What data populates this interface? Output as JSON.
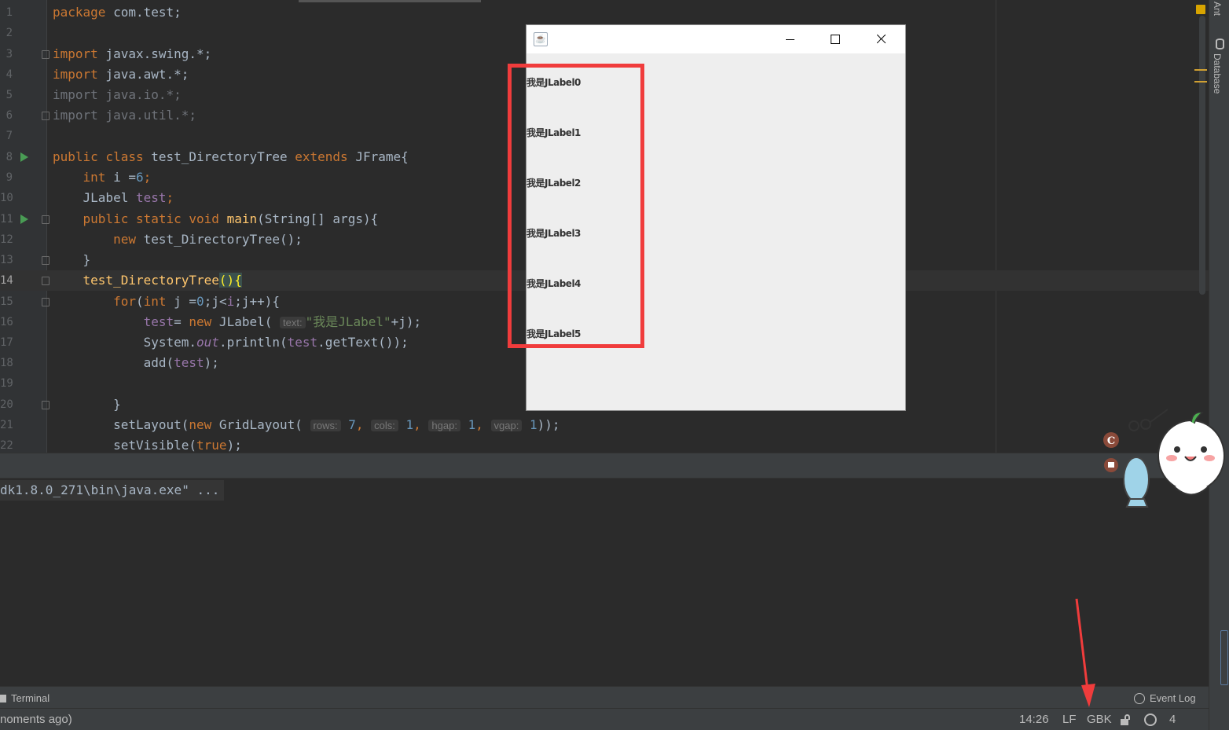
{
  "editor": {
    "lines": [
      {
        "n": "1"
      },
      {
        "n": "2"
      },
      {
        "n": "3"
      },
      {
        "n": "4"
      },
      {
        "n": "5"
      },
      {
        "n": "6"
      },
      {
        "n": "7"
      },
      {
        "n": "8"
      },
      {
        "n": "9"
      },
      {
        "n": "10"
      },
      {
        "n": "11"
      },
      {
        "n": "12"
      },
      {
        "n": "13"
      },
      {
        "n": "14"
      },
      {
        "n": "15"
      },
      {
        "n": "16"
      },
      {
        "n": "17"
      },
      {
        "n": "18"
      },
      {
        "n": "19"
      },
      {
        "n": "20"
      },
      {
        "n": "21"
      },
      {
        "n": "22"
      }
    ],
    "current_line": "14",
    "code": {
      "l1_kw": "package",
      "l1_rest": " com.test;",
      "l3_kw": "import",
      "l3_rest": " javax.swing.*;",
      "l4_kw": "import",
      "l4_rest": " java.awt.*;",
      "l5": "import java.io.*;",
      "l6": "import java.util.*;",
      "l8_kw": "public class",
      "l8_name": " test_DirectoryTree ",
      "l8_ext": "extends",
      "l8_rest": " JFrame{",
      "l9_kw": "    int",
      "l9_var": " i =",
      "l9_num": "6",
      "l9_end": ";",
      "l10_type": "    JLabel ",
      "l10_fld": "test",
      "l10_end": ";",
      "l11_kw": "    public static void ",
      "l11_fn": "main",
      "l11_rest": "(String[] args){",
      "l12_kw": "        new",
      "l12_rest": " test_DirectoryTree();",
      "l13": "    }",
      "l14_fn": "    test_DirectoryTree",
      "l14_hl": "(){",
      "l15_kw": "        for",
      "l15_a": "(",
      "l15_int": "int",
      "l15_b": " j =",
      "l15_num": "0",
      "l15_c": ";j<",
      "l15_fld": "i",
      "l15_d": ";j++){",
      "l16_fld": "            test",
      "l16_a": "= ",
      "l16_kw": "new",
      "l16_b": " JLabel( ",
      "l16_hint": "text:",
      "l16_str": "\"我是JLabel\"",
      "l16_c": "+j);",
      "l17_a": "            System.",
      "l17_out": "out",
      "l17_b": ".println(",
      "l17_fld": "test",
      "l17_c": ".getText());",
      "l18_a": "            add(",
      "l18_fld": "test",
      "l18_b": ");",
      "l20": "        }",
      "l21_a": "        setLayout(",
      "l21_kw": "new",
      "l21_b": " GridLayout( ",
      "l21_h1": "rows:",
      "l21_n1": "7",
      "l21_h2": "cols:",
      "l21_n2": "1",
      "l21_h3": "hgap:",
      "l21_n3": "1",
      "l21_h4": "vgap:",
      "l21_n4": "1",
      "l21_c": "));",
      "l22_a": "        setVisible(",
      "l22_kw": "true",
      "l22_b": ");"
    }
  },
  "right_strip": {
    "ant": "Ant",
    "database": "Database"
  },
  "console": {
    "line": "dk1.8.0_271\\bin\\java.exe\" ..."
  },
  "toolwindows": {
    "terminal": "Terminal",
    "event_log": "Event Log"
  },
  "status": {
    "message": "noments ago)",
    "position": "14:26",
    "line_sep": "LF",
    "encoding": "GBK",
    "indent": "4 spaces"
  },
  "java_window": {
    "labels": [
      "我是JLabel0",
      "我是JLabel1",
      "我是JLabel2",
      "我是JLabel3",
      "我是JLabel4",
      "我是JLabel5"
    ],
    "java_icon": "java-cup-icon"
  },
  "colors": {
    "editor_bg": "#2b2b2b",
    "keyword": "#cc7832",
    "annotation_red": "#f03c3c"
  }
}
